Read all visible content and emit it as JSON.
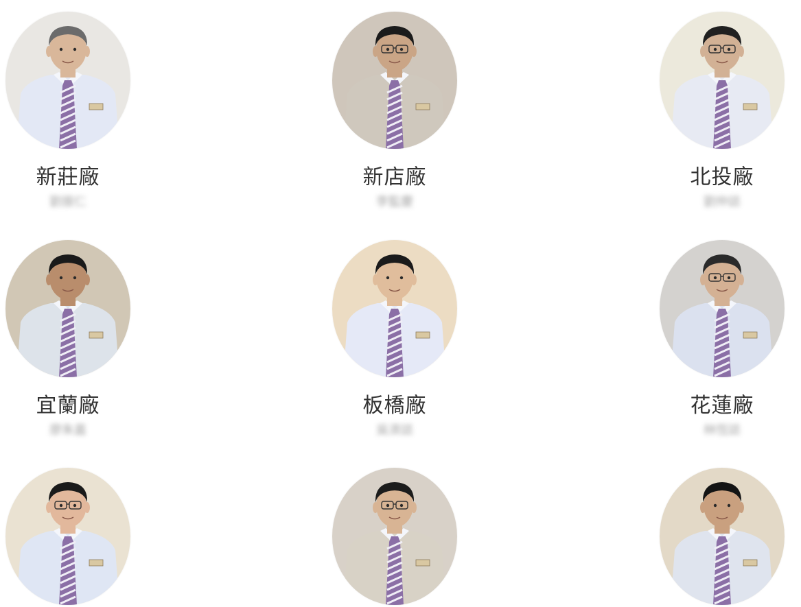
{
  "managers": [
    {
      "plant": "新莊廠",
      "name": "劉振仁",
      "bg": "#e9e7e3",
      "skin": "#d9b79a",
      "hair": "#6b6b6b",
      "shirt": "#e3e8f5",
      "glasses": false
    },
    {
      "plant": "新店廠",
      "name": "李監慶",
      "bg": "#cfc6bb",
      "skin": "#caa586",
      "hair": "#1b1b1b",
      "shirt": "#cfc8bd",
      "glasses": true
    },
    {
      "plant": "北投廠",
      "name": "劉仲誌",
      "bg": "#ece9dc",
      "skin": "#d2b195",
      "hair": "#202020",
      "shirt": "#e7eaf3",
      "glasses": true
    },
    {
      "plant": "宜蘭廠",
      "name": "廖朱嘉",
      "bg": "#d1c7b5",
      "skin": "#b98d6c",
      "hair": "#1a1a1a",
      "shirt": "#dde3ea",
      "glasses": false
    },
    {
      "plant": "板橋廠",
      "name": "吳濟誌",
      "bg": "#ecdcc3",
      "skin": "#e0bd9c",
      "hair": "#1b1b1b",
      "shirt": "#e5e9f7",
      "glasses": false
    },
    {
      "plant": "花蓮廠",
      "name": "林恆誌",
      "bg": "#d4d2cf",
      "skin": "#d4b194",
      "hair": "#2a2a2a",
      "shirt": "#dbe1ef",
      "glasses": true
    },
    {
      "plant": "",
      "name": "",
      "bg": "#eae2d2",
      "skin": "#e2b89c",
      "hair": "#1a1a1a",
      "shirt": "#dfe6f4",
      "glasses": true
    },
    {
      "plant": "",
      "name": "",
      "bg": "#d8d1c8",
      "skin": "#d8b494",
      "hair": "#1c1c1c",
      "shirt": "#d8d2c6",
      "glasses": true
    },
    {
      "plant": "",
      "name": "",
      "bg": "#e3d9c7",
      "skin": "#c9a07f",
      "hair": "#141414",
      "shirt": "#dfe4ee",
      "glasses": false
    }
  ]
}
